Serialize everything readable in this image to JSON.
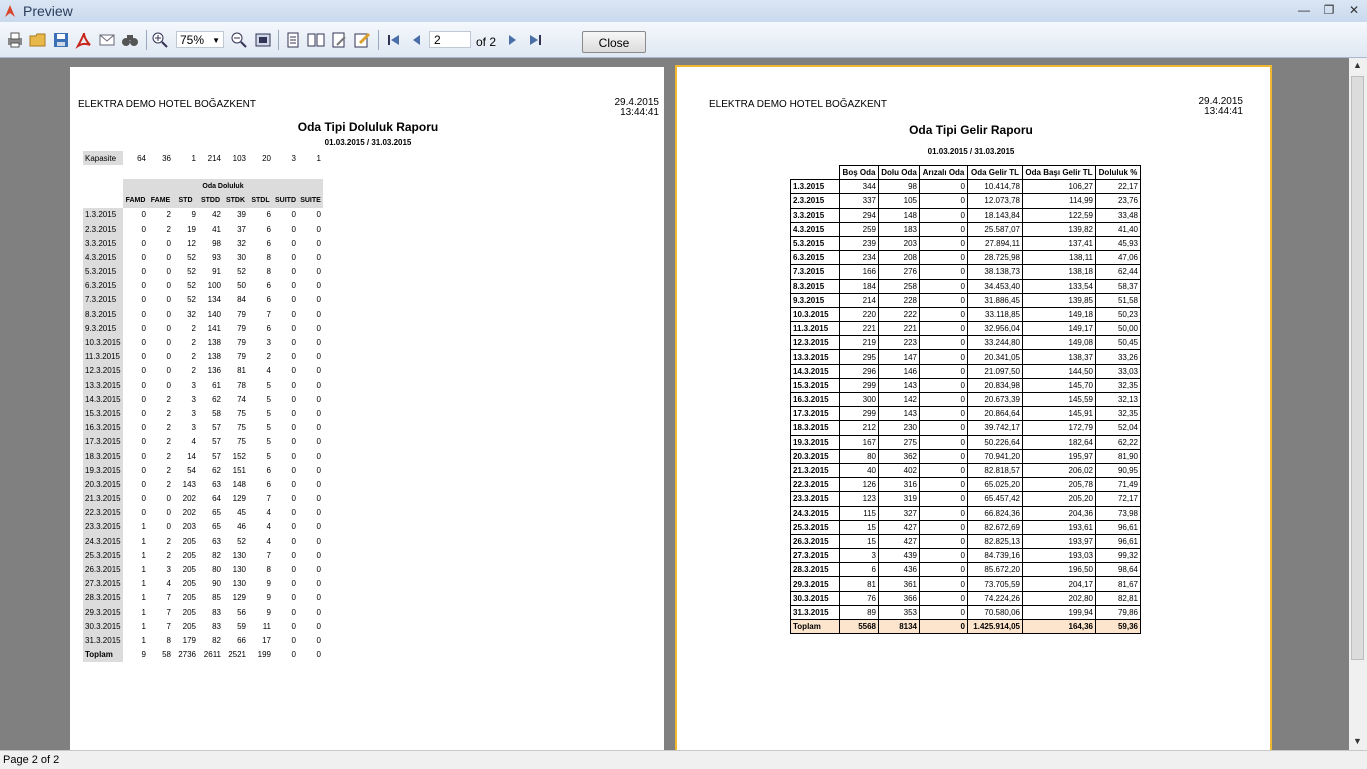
{
  "window": {
    "title": "Preview",
    "minimize": "—",
    "maximize": "❐",
    "close": "✕"
  },
  "toolbar": {
    "zoom_value": "75%",
    "page_value": "2",
    "of_label": "of 2",
    "close_label": "Close"
  },
  "status": {
    "text": "Page 2 of 2"
  },
  "page1": {
    "hotel": "ELEKTRA DEMO HOTEL BOĞAZKENT",
    "date": "29.4.2015",
    "time": "13:44:41",
    "title": "Oda Tipi Doluluk Raporu",
    "range": "01.03.2015 / 31.03.2015",
    "capacity_label": "Kapasite",
    "capacity": [
      "64",
      "36",
      "1",
      "214",
      "103",
      "20",
      "3",
      "1"
    ],
    "group_header": "Oda Doluluk",
    "columns": [
      "FAMD",
      "FAME",
      "STD",
      "STDD",
      "STDK",
      "STDL",
      "SUITD",
      "SUITE"
    ],
    "rows": [
      [
        "1.3.2015",
        "0",
        "2",
        "9",
        "42",
        "39",
        "6",
        "0",
        "0"
      ],
      [
        "2.3.2015",
        "0",
        "2",
        "19",
        "41",
        "37",
        "6",
        "0",
        "0"
      ],
      [
        "3.3.2015",
        "0",
        "0",
        "12",
        "98",
        "32",
        "6",
        "0",
        "0"
      ],
      [
        "4.3.2015",
        "0",
        "0",
        "52",
        "93",
        "30",
        "8",
        "0",
        "0"
      ],
      [
        "5.3.2015",
        "0",
        "0",
        "52",
        "91",
        "52",
        "8",
        "0",
        "0"
      ],
      [
        "6.3.2015",
        "0",
        "0",
        "52",
        "100",
        "50",
        "6",
        "0",
        "0"
      ],
      [
        "7.3.2015",
        "0",
        "0",
        "52",
        "134",
        "84",
        "6",
        "0",
        "0"
      ],
      [
        "8.3.2015",
        "0",
        "0",
        "32",
        "140",
        "79",
        "7",
        "0",
        "0"
      ],
      [
        "9.3.2015",
        "0",
        "0",
        "2",
        "141",
        "79",
        "6",
        "0",
        "0"
      ],
      [
        "10.3.2015",
        "0",
        "0",
        "2",
        "138",
        "79",
        "3",
        "0",
        "0"
      ],
      [
        "11.3.2015",
        "0",
        "0",
        "2",
        "138",
        "79",
        "2",
        "0",
        "0"
      ],
      [
        "12.3.2015",
        "0",
        "0",
        "2",
        "136",
        "81",
        "4",
        "0",
        "0"
      ],
      [
        "13.3.2015",
        "0",
        "0",
        "3",
        "61",
        "78",
        "5",
        "0",
        "0"
      ],
      [
        "14.3.2015",
        "0",
        "2",
        "3",
        "62",
        "74",
        "5",
        "0",
        "0"
      ],
      [
        "15.3.2015",
        "0",
        "2",
        "3",
        "58",
        "75",
        "5",
        "0",
        "0"
      ],
      [
        "16.3.2015",
        "0",
        "2",
        "3",
        "57",
        "75",
        "5",
        "0",
        "0"
      ],
      [
        "17.3.2015",
        "0",
        "2",
        "4",
        "57",
        "75",
        "5",
        "0",
        "0"
      ],
      [
        "18.3.2015",
        "0",
        "2",
        "14",
        "57",
        "152",
        "5",
        "0",
        "0"
      ],
      [
        "19.3.2015",
        "0",
        "2",
        "54",
        "62",
        "151",
        "6",
        "0",
        "0"
      ],
      [
        "20.3.2015",
        "0",
        "2",
        "143",
        "63",
        "148",
        "6",
        "0",
        "0"
      ],
      [
        "21.3.2015",
        "0",
        "0",
        "202",
        "64",
        "129",
        "7",
        "0",
        "0"
      ],
      [
        "22.3.2015",
        "0",
        "0",
        "202",
        "65",
        "45",
        "4",
        "0",
        "0"
      ],
      [
        "23.3.2015",
        "1",
        "0",
        "203",
        "65",
        "46",
        "4",
        "0",
        "0"
      ],
      [
        "24.3.2015",
        "1",
        "2",
        "205",
        "63",
        "52",
        "4",
        "0",
        "0"
      ],
      [
        "25.3.2015",
        "1",
        "2",
        "205",
        "82",
        "130",
        "7",
        "0",
        "0"
      ],
      [
        "26.3.2015",
        "1",
        "3",
        "205",
        "80",
        "130",
        "8",
        "0",
        "0"
      ],
      [
        "27.3.2015",
        "1",
        "4",
        "205",
        "90",
        "130",
        "9",
        "0",
        "0"
      ],
      [
        "28.3.2015",
        "1",
        "7",
        "205",
        "85",
        "129",
        "9",
        "0",
        "0"
      ],
      [
        "29.3.2015",
        "1",
        "7",
        "205",
        "83",
        "56",
        "9",
        "0",
        "0"
      ],
      [
        "30.3.2015",
        "1",
        "7",
        "205",
        "83",
        "59",
        "11",
        "0",
        "0"
      ],
      [
        "31.3.2015",
        "1",
        "8",
        "179",
        "82",
        "66",
        "17",
        "0",
        "0"
      ]
    ],
    "total": [
      "Toplam",
      "9",
      "58",
      "2736",
      "2611",
      "2521",
      "199",
      "0",
      "0"
    ]
  },
  "page2": {
    "hotel": "ELEKTRA DEMO HOTEL BOĞAZKENT",
    "date": "29.4.2015",
    "time": "13:44:41",
    "title": "Oda Tipi Gelir Raporu",
    "range": "01.03.2015 / 31.03.2015",
    "columns": [
      "Boş Oda",
      "Dolu Oda",
      "Arızalı Oda",
      "Oda Gelir TL",
      "Oda Başı Gelir TL",
      "Doluluk %"
    ],
    "rows": [
      [
        "1.3.2015",
        "344",
        "98",
        "0",
        "10.414,78",
        "106,27",
        "22,17"
      ],
      [
        "2.3.2015",
        "337",
        "105",
        "0",
        "12.073,78",
        "114,99",
        "23,76"
      ],
      [
        "3.3.2015",
        "294",
        "148",
        "0",
        "18.143,84",
        "122,59",
        "33,48"
      ],
      [
        "4.3.2015",
        "259",
        "183",
        "0",
        "25.587,07",
        "139,82",
        "41,40"
      ],
      [
        "5.3.2015",
        "239",
        "203",
        "0",
        "27.894,11",
        "137,41",
        "45,93"
      ],
      [
        "6.3.2015",
        "234",
        "208",
        "0",
        "28.725,98",
        "138,11",
        "47,06"
      ],
      [
        "7.3.2015",
        "166",
        "276",
        "0",
        "38.138,73",
        "138,18",
        "62,44"
      ],
      [
        "8.3.2015",
        "184",
        "258",
        "0",
        "34.453,40",
        "133,54",
        "58,37"
      ],
      [
        "9.3.2015",
        "214",
        "228",
        "0",
        "31.886,45",
        "139,85",
        "51,58"
      ],
      [
        "10.3.2015",
        "220",
        "222",
        "0",
        "33.118,85",
        "149,18",
        "50,23"
      ],
      [
        "11.3.2015",
        "221",
        "221",
        "0",
        "32.956,04",
        "149,17",
        "50,00"
      ],
      [
        "12.3.2015",
        "219",
        "223",
        "0",
        "33.244,80",
        "149,08",
        "50,45"
      ],
      [
        "13.3.2015",
        "295",
        "147",
        "0",
        "20.341,05",
        "138,37",
        "33,26"
      ],
      [
        "14.3.2015",
        "296",
        "146",
        "0",
        "21.097,50",
        "144,50",
        "33,03"
      ],
      [
        "15.3.2015",
        "299",
        "143",
        "0",
        "20.834,98",
        "145,70",
        "32,35"
      ],
      [
        "16.3.2015",
        "300",
        "142",
        "0",
        "20.673,39",
        "145,59",
        "32,13"
      ],
      [
        "17.3.2015",
        "299",
        "143",
        "0",
        "20.864,64",
        "145,91",
        "32,35"
      ],
      [
        "18.3.2015",
        "212",
        "230",
        "0",
        "39.742,17",
        "172,79",
        "52,04"
      ],
      [
        "19.3.2015",
        "167",
        "275",
        "0",
        "50.226,64",
        "182,64",
        "62,22"
      ],
      [
        "20.3.2015",
        "80",
        "362",
        "0",
        "70.941,20",
        "195,97",
        "81,90"
      ],
      [
        "21.3.2015",
        "40",
        "402",
        "0",
        "82.818,57",
        "206,02",
        "90,95"
      ],
      [
        "22.3.2015",
        "126",
        "316",
        "0",
        "65.025,20",
        "205,78",
        "71,49"
      ],
      [
        "23.3.2015",
        "123",
        "319",
        "0",
        "65.457,42",
        "205,20",
        "72,17"
      ],
      [
        "24.3.2015",
        "115",
        "327",
        "0",
        "66.824,36",
        "204,36",
        "73,98"
      ],
      [
        "25.3.2015",
        "15",
        "427",
        "0",
        "82.672,69",
        "193,61",
        "96,61"
      ],
      [
        "26.3.2015",
        "15",
        "427",
        "0",
        "82.825,13",
        "193,97",
        "96,61"
      ],
      [
        "27.3.2015",
        "3",
        "439",
        "0",
        "84.739,16",
        "193,03",
        "99,32"
      ],
      [
        "28.3.2015",
        "6",
        "436",
        "0",
        "85.672,20",
        "196,50",
        "98,64"
      ],
      [
        "29.3.2015",
        "81",
        "361",
        "0",
        "73.705,59",
        "204,17",
        "81,67"
      ],
      [
        "30.3.2015",
        "76",
        "366",
        "0",
        "74.224,26",
        "202,80",
        "82,81"
      ],
      [
        "31.3.2015",
        "89",
        "353",
        "0",
        "70.580,06",
        "199,94",
        "79,86"
      ]
    ],
    "total": [
      "Toplam",
      "5568",
      "8134",
      "0",
      "1.425.914,05",
      "164,36",
      "59,36"
    ]
  }
}
